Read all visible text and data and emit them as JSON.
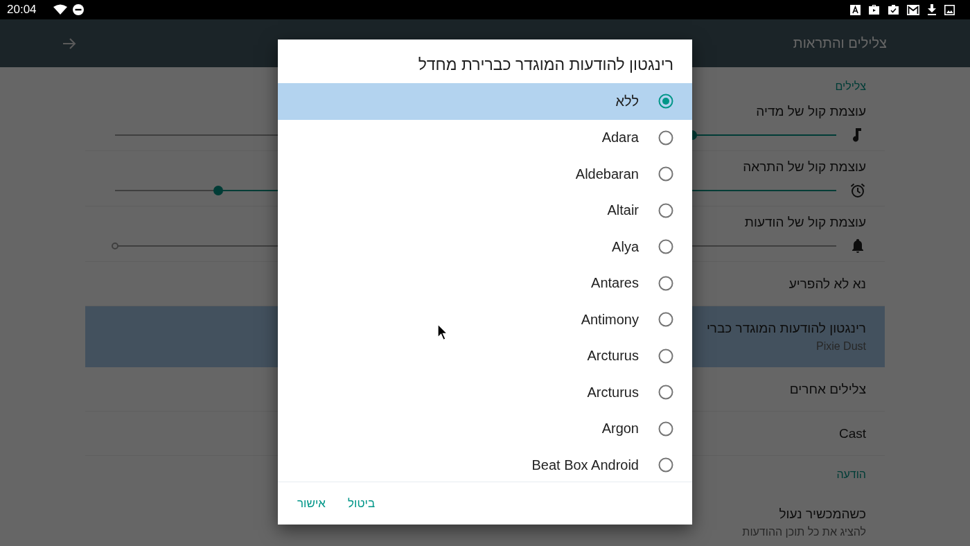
{
  "status_bar": {
    "time": "20:04"
  },
  "app_bar": {
    "title": "צלילים והתראות"
  },
  "settings": [
    {
      "kind": "header",
      "text": "צלילים"
    },
    {
      "kind": "slider",
      "title": "עוצמת קול של מדיה",
      "level": 0.2,
      "disabled": false
    },
    {
      "kind": "slider",
      "title": "עוצמת קול של התראה",
      "level": 0.857,
      "disabled": false
    },
    {
      "kind": "slider",
      "title": "עוצמת קול של הודעות",
      "disabled": true
    },
    {
      "kind": "item",
      "title": "נא לא להפריע",
      "selected": false
    },
    {
      "kind": "item",
      "title": "רינגטון להודעות המוגדר כברי",
      "summary": "Pixie Dust",
      "selected": true
    },
    {
      "kind": "item",
      "title": "צלילים אחרים",
      "selected": false
    },
    {
      "kind": "item",
      "title": "Cast",
      "selected": false
    },
    {
      "kind": "header",
      "text": "הודעה"
    },
    {
      "kind": "item",
      "title": "כשהמכשיר נעול",
      "summary": "להציג את כל תוכן ההודעות",
      "selected": false
    }
  ],
  "dialog": {
    "title": "רינגטון להודעות המוגדר כברירת מחדל",
    "options": [
      {
        "label": "ללא",
        "selected": true
      },
      {
        "label": "Adara",
        "selected": false
      },
      {
        "label": "Aldebaran",
        "selected": false
      },
      {
        "label": "Altair",
        "selected": false
      },
      {
        "label": "Alya",
        "selected": false
      },
      {
        "label": "Antares",
        "selected": false
      },
      {
        "label": "Antimony",
        "selected": false
      },
      {
        "label": "Arcturus",
        "selected": false
      },
      {
        "label": "Arcturus",
        "selected": false
      },
      {
        "label": "Argon",
        "selected": false
      },
      {
        "label": "Beat Box Android",
        "selected": false
      }
    ],
    "buttons": [
      "ביטול",
      "אישור"
    ]
  }
}
